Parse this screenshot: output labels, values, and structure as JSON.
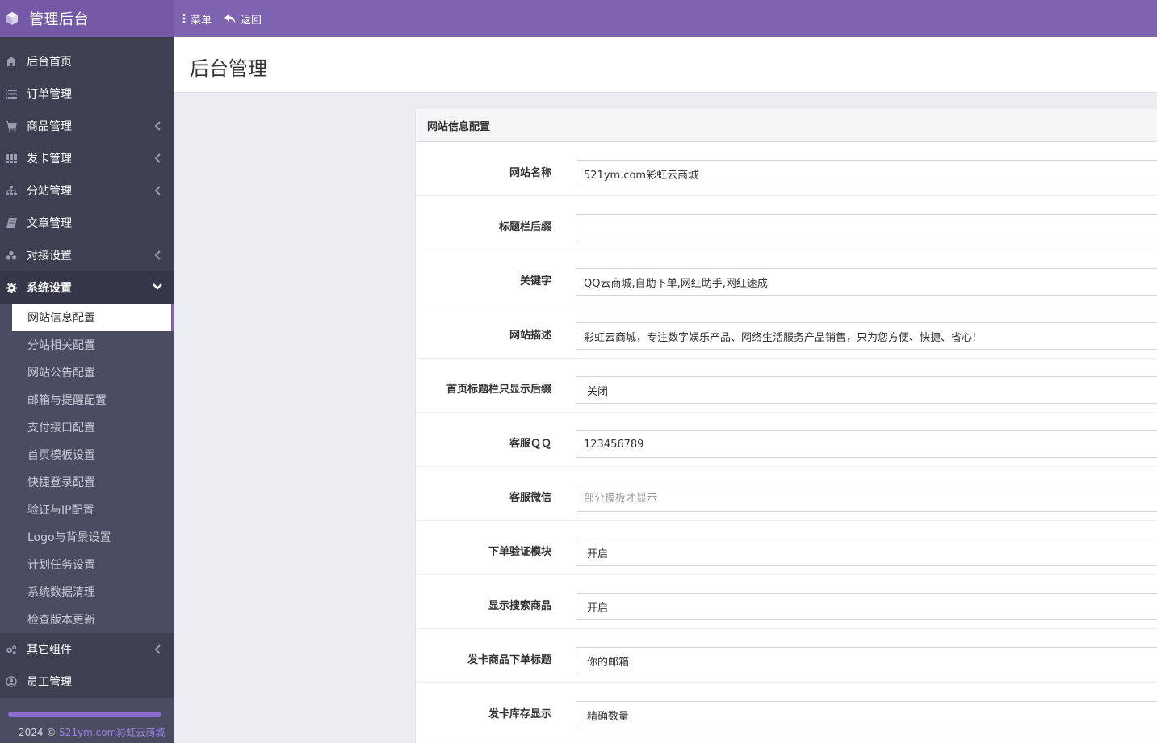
{
  "brand": {
    "title": "管理后台",
    "logo_icon": "cube-icon"
  },
  "topbar": {
    "menu_label": "菜单",
    "back_label": "返回",
    "color": "#7e63b0"
  },
  "sidebar": {
    "items": [
      {
        "label": "后台首页",
        "icon": "home-icon"
      },
      {
        "label": "订单管理",
        "icon": "list-icon"
      },
      {
        "label": "商品管理",
        "icon": "cart-icon"
      },
      {
        "label": "发卡管理",
        "icon": "grid-icon"
      },
      {
        "label": "分站管理",
        "icon": "sitemap-icon"
      },
      {
        "label": "文章管理",
        "icon": "book-icon"
      },
      {
        "label": "对接设置",
        "icon": "cubes-icon"
      },
      {
        "label": "系统设置",
        "icon": "gear-icon"
      }
    ],
    "submenu": [
      "网站信息配置",
      "分站相关配置",
      "网站公告配置",
      "邮箱与提醒配置",
      "支付接口配置",
      "首页模板设置",
      "快捷登录配置",
      "验证与IP配置",
      "Logo与背景设置",
      "计划任务设置",
      "系统数据清理",
      "检查版本更新"
    ],
    "bottom_items": [
      {
        "label": "其它组件",
        "icon": "gears-icon"
      },
      {
        "label": "员工管理",
        "icon": "user-circle-icon"
      }
    ],
    "footer_prefix": "2024 © ",
    "footer_link": "521ym.com彩虹云商城"
  },
  "header": {
    "title": "后台管理"
  },
  "panel": {
    "heading": "网站信息配置",
    "fields": [
      {
        "label": "网站名称",
        "value": "521ym.com彩虹云商城",
        "placeholder": ""
      },
      {
        "label": "标题栏后缀",
        "value": "",
        "placeholder": ""
      },
      {
        "label": "关键字",
        "value": "QQ云商城,自助下单,网红助手,网红速成",
        "placeholder": ""
      },
      {
        "label": "网站描述",
        "value": "彩虹云商城，专注数字娱乐产品、网络生活服务产品销售，只为您方便、快捷、省心！",
        "placeholder": ""
      },
      {
        "label": "首页标题栏只显示后缀",
        "value": "关闭"
      },
      {
        "label": "客服ＱＱ",
        "value": "123456789",
        "placeholder": ""
      },
      {
        "label": "客服微信",
        "value": "",
        "placeholder": "部分模板才显示"
      },
      {
        "label": "下单验证模块",
        "value": "开启"
      },
      {
        "label": "显示搜索商品",
        "value": "开启"
      },
      {
        "label": "发卡商品下单标题",
        "value": "你的邮箱"
      },
      {
        "label": "发卡库存显示",
        "value": "精确数量"
      }
    ]
  }
}
